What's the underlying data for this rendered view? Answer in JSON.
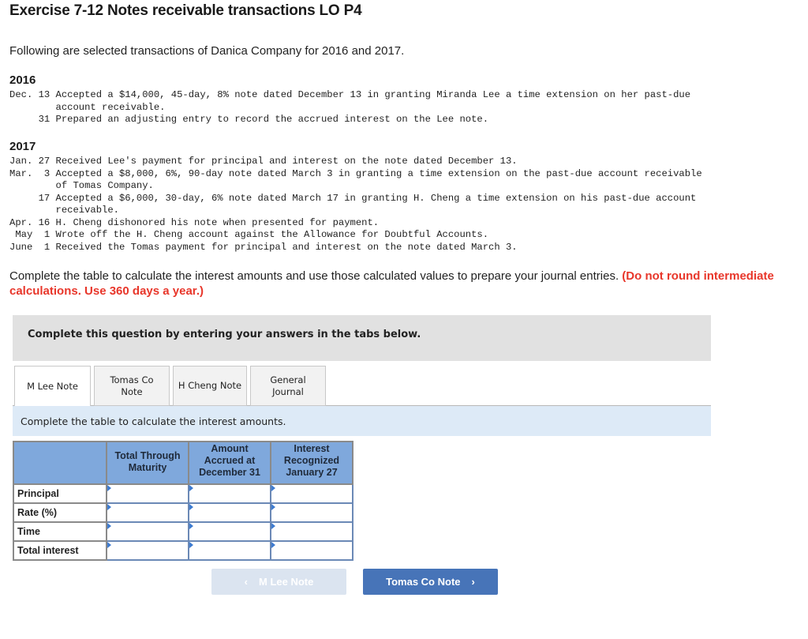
{
  "title": "Exercise 7-12 Notes receivable transactions LO P4",
  "intro": "Following are selected transactions of Danica Company for 2016 and 2017.",
  "years": [
    {
      "year": "2016",
      "lines": [
        "Dec. 13 Accepted a $14,000, 45-day, 8% note dated December 13 in granting Miranda Lee a time extension on her past-due",
        "        account receivable.",
        "     31 Prepared an adjusting entry to record the accrued interest on the Lee note."
      ]
    },
    {
      "year": "2017",
      "lines": [
        "Jan. 27 Received Lee's payment for principal and interest on the note dated December 13.",
        "Mar.  3 Accepted a $8,000, 6%, 90-day note dated March 3 in granting a time extension on the past-due account receivable",
        "        of Tomas Company.",
        "     17 Accepted a $6,000, 30-day, 6% note dated March 17 in granting H. Cheng a time extension on his past-due account",
        "        receivable.",
        "Apr. 16 H. Cheng dishonored his note when presented for payment.",
        " May  1 Wrote off the H. Cheng account against the Allowance for Doubtful Accounts.",
        "June  1 Received the Tomas payment for principal and interest on the note dated March 3."
      ]
    }
  ],
  "instruction": {
    "text": "Complete the table to calculate the interest amounts and use those calculated values to prepare your journal entries. ",
    "emphasis": "(Do not round intermediate calculations. Use 360 days a year.)"
  },
  "banner": "Complete this question by entering your answers in the tabs below.",
  "tabs": [
    {
      "label": "M Lee Note",
      "active": true
    },
    {
      "label": "Tomas Co Note",
      "active": false
    },
    {
      "label": "H Cheng Note",
      "active": false
    },
    {
      "label": "General Journal",
      "active": false
    }
  ],
  "subinstruction": "Complete the table to calculate the interest amounts.",
  "table": {
    "columns": [
      "",
      "Total Through Maturity",
      "Amount Accrued at December 31",
      "Interest Recognized January 27"
    ],
    "rows": [
      {
        "label": "Principal",
        "values": [
          "",
          "",
          ""
        ]
      },
      {
        "label": "Rate (%)",
        "values": [
          "",
          "",
          ""
        ]
      },
      {
        "label": "Time",
        "values": [
          "",
          "",
          ""
        ]
      },
      {
        "label": "Total interest",
        "values": [
          "",
          "",
          ""
        ]
      }
    ]
  },
  "nav": {
    "prev_label": "M Lee Note",
    "prev_icon": "‹",
    "next_label": "Tomas Co Note",
    "next_icon": "›"
  }
}
